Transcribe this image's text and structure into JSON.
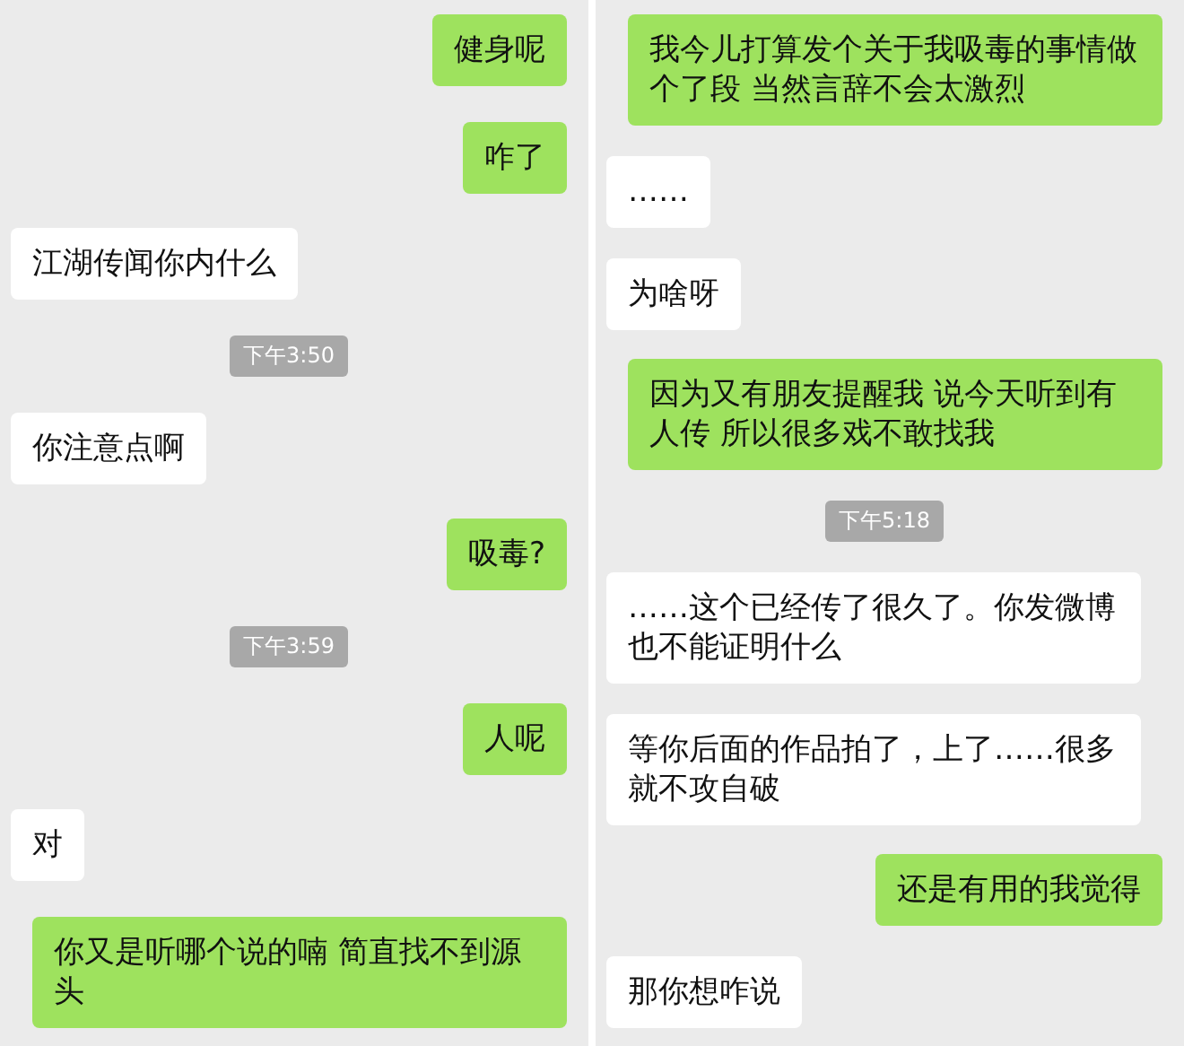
{
  "panels": [
    {
      "messages": [
        {
          "kind": "sent",
          "text": "健身呢"
        },
        {
          "kind": "sent",
          "text": "咋了"
        },
        {
          "kind": "received",
          "text": "江湖传闻你内什么"
        },
        {
          "kind": "time",
          "text": "下午3:50"
        },
        {
          "kind": "received",
          "text": "你注意点啊"
        },
        {
          "kind": "sent",
          "text": "吸毒?"
        },
        {
          "kind": "time",
          "text": "下午3:59"
        },
        {
          "kind": "sent",
          "text": "人呢"
        },
        {
          "kind": "received",
          "text": "对"
        },
        {
          "kind": "sent",
          "text": "你又是听哪个说的喃 简直找不到源头"
        }
      ]
    },
    {
      "messages": [
        {
          "kind": "sent",
          "text": "我今儿打算发个关于我吸毒的事情做个了段 当然言辞不会太激烈"
        },
        {
          "kind": "received",
          "text": "……"
        },
        {
          "kind": "received",
          "text": "为啥呀"
        },
        {
          "kind": "sent",
          "text": "因为又有朋友提醒我 说今天听到有人传 所以很多戏不敢找我"
        },
        {
          "kind": "time",
          "text": "下午5:18"
        },
        {
          "kind": "received",
          "text": "……这个已经传了很久了。你发微博也不能证明什么"
        },
        {
          "kind": "received",
          "text": "等你后面的作品拍了，上了……很多就不攻自破"
        },
        {
          "kind": "sent",
          "text": "还是有用的我觉得"
        },
        {
          "kind": "received",
          "text": "那你想咋说"
        }
      ]
    }
  ]
}
